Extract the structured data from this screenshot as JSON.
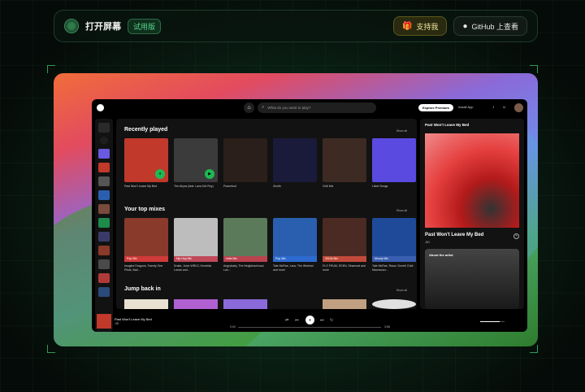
{
  "header": {
    "brand": "打开屏幕",
    "badge": "试用版",
    "support_label": "支持我",
    "github_label": "GitHub 上查看"
  },
  "spotify": {
    "search_placeholder": "What do you want to play?",
    "explore_label": "Explore Premium",
    "install_label": "Install App",
    "recently_played": {
      "title": "Recently played",
      "show_all": "Show all",
      "items": [
        {
          "caption": "Past Won't Leave My Bed",
          "color": "#c0392b"
        },
        {
          "caption": "The Abyss (feat. Lana Del Rey)",
          "color": "#3b3b3b"
        },
        {
          "caption": "Peacefruit",
          "color": "#2a1f1a"
        },
        {
          "caption": "Zenith",
          "color": "#1a1a3a"
        },
        {
          "caption": "Chill Mix",
          "color": "#3d2a22"
        },
        {
          "caption": "Liked Songs",
          "color": "#5b4ae0"
        }
      ]
    },
    "top_mixes": {
      "title": "Your top mixes",
      "show_all": "Show all",
      "items": [
        {
          "tag": "Pop Mix",
          "caption": "Imagine Dragons, Twenty One Pilots, Bad...",
          "color": "#8a3a2a",
          "tag_color": "#d03a3a"
        },
        {
          "tag": "Hip Hop Mix",
          "caption": "Drake, Juice WRLD, Kendrick Lamar and...",
          "color": "#bdbdbd",
          "tag_color": "#c14a5a"
        },
        {
          "tag": "Indie Mix",
          "caption": "Angrybaby, The Neighbourhood, Lan...",
          "color": "#5a7a5a",
          "tag_color": "#b9424f"
        },
        {
          "tag": "Pop Mix",
          "caption": "Tate McRae, Lauv, The Weeknd and more",
          "color": "#2a5fb0",
          "tag_color": "#2d6bcf"
        },
        {
          "tag": "2010s Mix",
          "caption": "FLO FRUM, EDEN, Sinsemat and more",
          "color": "#4a2a22",
          "tag_color": "#c24a3a"
        },
        {
          "tag": "Moody Mix",
          "caption": "Tate McRae, Rauw, Sorrell, Eddi Macmoran...",
          "color": "#1f4a9a",
          "tag_color": "#3a5fb0"
        }
      ]
    },
    "jump_back": {
      "title": "Jump back in",
      "show_all": "Show all"
    },
    "right_panel": {
      "title": "Past Won't Leave My Bed",
      "song": "Past Won't Leave My Bed",
      "artist": "JID",
      "about": "About the artist"
    },
    "player": {
      "song": "Past Won't Leave My Bed",
      "artist": "JID",
      "time_elapsed": "0:00",
      "time_total": "3:58",
      "volume": 0.8
    }
  }
}
